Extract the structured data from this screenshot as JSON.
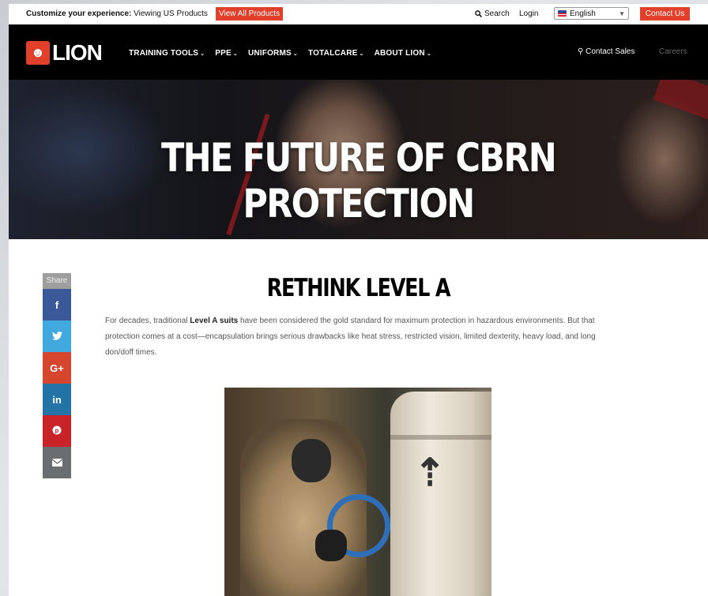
{
  "utility": {
    "customize_label": "Customize your experience:",
    "viewing_text": "Viewing US Products",
    "view_all_button": "View All Products",
    "search_label": "Search",
    "login_label": "Login",
    "language_selected": "English",
    "contact_button": "Contact Us"
  },
  "nav": {
    "logo_text": "LION",
    "items": [
      {
        "label": "TRAINING TOOLS"
      },
      {
        "label": "PPE"
      },
      {
        "label": "UNIFORMS"
      },
      {
        "label": "TOTALCARE"
      },
      {
        "label": "ABOUT LION"
      }
    ],
    "contact_sales": "Contact Sales",
    "careers": "Careers"
  },
  "hero": {
    "title": "THE FUTURE OF CBRN PROTECTION"
  },
  "share": {
    "label": "Share",
    "buttons": [
      {
        "name": "facebook",
        "glyph": "f",
        "color": "#3b5998"
      },
      {
        "name": "twitter",
        "glyph": "🐦",
        "color": "#41a9dd"
      },
      {
        "name": "google-plus",
        "glyph": "G+",
        "color": "#d6462f"
      },
      {
        "name": "linkedin",
        "glyph": "in",
        "color": "#2473a6"
      },
      {
        "name": "pinterest",
        "glyph": "℗",
        "color": "#c92228"
      },
      {
        "name": "email",
        "glyph": "✉",
        "color": "#6b6e70"
      }
    ]
  },
  "content": {
    "section_title": "RETHINK LEVEL A",
    "intro_before": "For decades, traditional ",
    "intro_bold": "Level A suits",
    "intro_after": " have been considered the gold standard for maximum protection in hazardous environments. But that protection comes at a cost—encapsulation brings serious drawbacks like heat stress, restricted vision, limited dexterity, heavy load, and long don/doff times."
  },
  "colors": {
    "brand_red": "#e2402b",
    "nav_bg": "#000000"
  }
}
